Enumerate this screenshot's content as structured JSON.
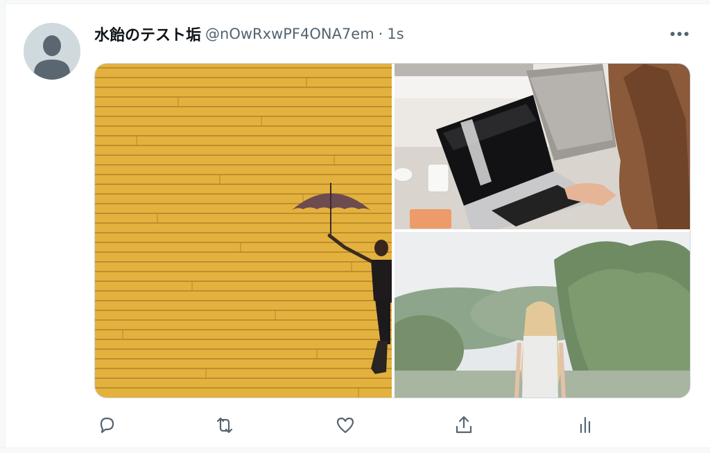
{
  "tweet": {
    "display_name": "水飴のテスト垢",
    "handle": "@nOwRxwPF4ONA7em",
    "separator": "·",
    "timestamp": "1s"
  },
  "icons": {
    "avatar": "default-profile-icon",
    "more": "more-options-icon",
    "reply": "reply-icon",
    "retweet": "retweet-icon",
    "like": "heart-icon",
    "share": "share-icon",
    "analytics": "analytics-icon"
  },
  "colors": {
    "text_primary": "#0f1419",
    "text_secondary": "#536471",
    "icon": "#536471",
    "avatar_bg": "#cfd9de"
  }
}
